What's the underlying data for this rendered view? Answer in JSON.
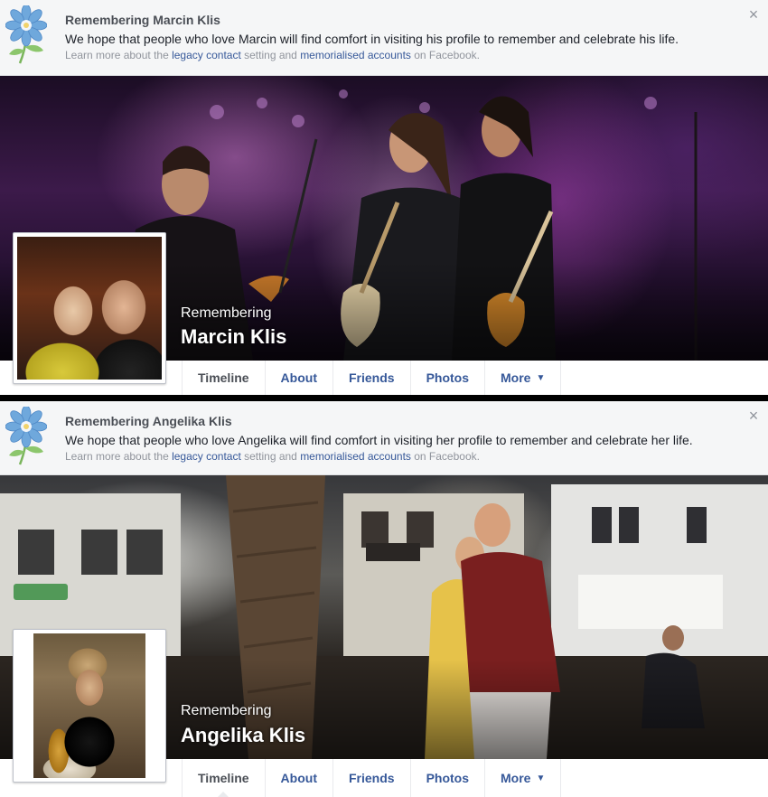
{
  "profiles": [
    {
      "banner": {
        "title": "Remembering Marcin Klis",
        "message": "We hope that people who love Marcin will find comfort in visiting his profile to remember and celebrate his life.",
        "learn_prefix": "Learn more about the ",
        "legacy_link": "legacy contact",
        "learn_middle": " setting and ",
        "memorial_link": "memorialised accounts",
        "learn_suffix": " on Facebook.",
        "close_icon": "×"
      },
      "remembering_label": "Remembering",
      "name": "Marcin Klis",
      "tabs": [
        {
          "label": "Timeline"
        },
        {
          "label": "About"
        },
        {
          "label": "Friends"
        },
        {
          "label": "Photos"
        },
        {
          "label": "More",
          "caret": "▼"
        }
      ]
    },
    {
      "banner": {
        "title": "Remembering Angelika Klis",
        "message": "We hope that people who love Angelika will find comfort in visiting her profile to remember and celebrate her life.",
        "learn_prefix": "Learn more about the ",
        "legacy_link": "legacy contact",
        "learn_middle": " setting and ",
        "memorial_link": "memorialised accounts",
        "learn_suffix": " on Facebook.",
        "close_icon": "×"
      },
      "remembering_label": "Remembering",
      "name": "Angelika Klis",
      "tabs": [
        {
          "label": "Timeline"
        },
        {
          "label": "About"
        },
        {
          "label": "Friends"
        },
        {
          "label": "Photos"
        },
        {
          "label": "More",
          "caret": "▼"
        }
      ]
    }
  ],
  "colors": {
    "link": "#365899",
    "banner_bg": "#f5f6f7",
    "flower": "#6fa8dc",
    "stem": "#7ab55c"
  }
}
